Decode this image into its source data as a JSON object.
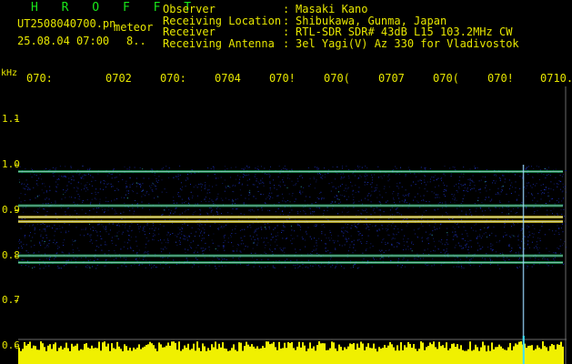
{
  "header": {
    "brand": "H R O F F T",
    "filename": "UT2508040700.pn",
    "tag": "meteor",
    "date_time": "25.08.04 07:00",
    "count": "8..",
    "info": [
      {
        "label": "Observer",
        "value": "Masaki Kano"
      },
      {
        "label": "Receiving Location",
        "value": "Shibukawa, Gunma, Japan"
      },
      {
        "label": "Receiver",
        "value": "RTL-SDR SDR# 43dB L15 103.2MHz CW"
      },
      {
        "label": "Receiving Antenna",
        "value": "3el Yagi(V) Az 330 for Vladivostok"
      }
    ],
    "separator": ":"
  },
  "axis": {
    "unit": "kHz",
    "x_ticks": [
      "070:",
      "0702",
      "070:",
      "0704",
      "070!",
      "070(",
      "0707",
      "070(",
      "070!",
      "0710."
    ],
    "y_ticks": [
      "1.1",
      "1.0",
      "0.9",
      "0.8",
      "0.7",
      "0.6"
    ]
  },
  "spectrogram": {
    "bands_khz": [
      0.985,
      0.91,
      0.885,
      0.875,
      0.8,
      0.785
    ],
    "noise_range_khz": [
      0.78,
      0.99
    ],
    "meteor_time_fraction": 0.92,
    "colors": {
      "noise": "#1e32c8",
      "band_hot": "#e8d020",
      "band_mid": "#22c86e",
      "signal_bar": "#f0f000",
      "frame": "#6a6a6a"
    }
  }
}
